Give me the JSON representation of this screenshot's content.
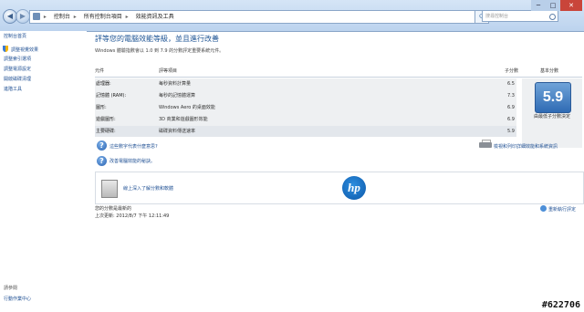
{
  "window": {
    "breadcrumb": [
      "控制台",
      "所有控制台項目",
      "效能資訊及工具"
    ],
    "search_placeholder": "搜尋控制台",
    "buttons": {
      "minimize": "─",
      "maximize": "□",
      "close": "✕"
    }
  },
  "sidebar": {
    "home": "控制台首頁",
    "items": [
      "調整視覺效果",
      "調整索引選項",
      "調整電源設定",
      "開啟磁碟清理",
      "進階工具"
    ],
    "see_also_title": "請參閱",
    "see_also_items": [
      "行動作業中心"
    ]
  },
  "main": {
    "heading": "評等您的電腦效能等級，並且進行改善",
    "description": "Windows 體驗指數會以 1.0 到 7.9 的分數評定重要系統元件。",
    "columns": {
      "component": "元件",
      "rated": "評等項目",
      "subscore": "子分數",
      "base": "基本分數"
    },
    "rows": [
      {
        "component": "處理器:",
        "rated": "每秒資料計算量",
        "subscore": "6.5"
      },
      {
        "component": "記憶體 (RAM):",
        "rated": "每秒的記憶體運算",
        "subscore": "7.3"
      },
      {
        "component": "圖形:",
        "rated": "Windows Aero 的桌面效能",
        "subscore": "6.9"
      },
      {
        "component": "遊戲圖形:",
        "rated": "3D 商業和遊戲圖形效能",
        "subscore": "6.9"
      },
      {
        "component": "主要硬碟:",
        "rated": "磁碟資料傳送速率",
        "subscore": "5.9"
      }
    ],
    "base_score": "5.9",
    "base_caption": "由最低子分數決定",
    "help_links": [
      "這些數字代表什麼意思?",
      "改善電腦效能的秘訣。"
    ],
    "print_link": "檢視和列印詳細效能和系統資訊",
    "panel_link": "線上深入了解分數和軟體",
    "brand_logo": "hp",
    "status_line1": "您的分數是最新的",
    "status_line2": "上次更新: 2012/8/7 下午 12:11:49",
    "rerun_link": "重新執行評定"
  },
  "watermark": "#622706"
}
